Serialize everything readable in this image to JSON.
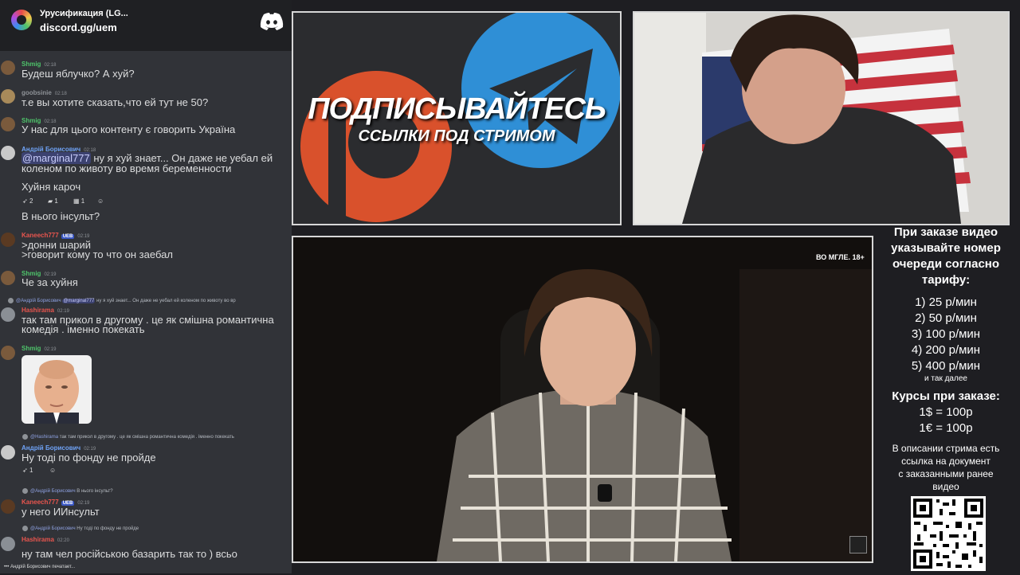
{
  "server": {
    "name": "Урусификация (LG...",
    "invite": "discord.gg/uem"
  },
  "chat": [
    {
      "user": "Shmig",
      "time": "02:18",
      "color": "#4ec36a",
      "lines": [
        "Будеш яблучко? А хуй?"
      ]
    },
    {
      "user": "goobsinie",
      "time": "02:18",
      "color": "#8e9297",
      "lines": [
        "т.е вы хотите сказать,что ей тут не 50?"
      ]
    },
    {
      "user": "Shmig",
      "time": "02:18",
      "color": "#4ec36a",
      "lines": [
        "У нас для цього контенту є говорить Україна"
      ]
    },
    {
      "user": "Андрій Борисович",
      "time": "02:18",
      "color": "#6fa3f7",
      "mention": "@marginal777",
      "lines": [
        " ну я хуй знает... Он даже не уебал ей",
        "коленом по животу во время беременности"
      ],
      "extra": [
        "Хуйня кароч",
        "В нього інсульт?"
      ],
      "reactions": [
        "2",
        "1",
        "1"
      ]
    },
    {
      "user": "Kaneech777",
      "time": "02:19",
      "color": "#e8554e",
      "badge": "UEB",
      "lines": [
        ">донни шарий",
        ">говорит кому то что он заебал"
      ]
    },
    {
      "user": "Shmig",
      "time": "02:19",
      "color": "#4ec36a",
      "lines": [
        "Че за хуйня"
      ]
    },
    {
      "reply_user": "@Андрій Борисович",
      "reply_mention": "@marginal777",
      "reply_text": " ну я хуй знает... Он даже не уебал ей коленом по животу во вр",
      "user": "Hashirama",
      "time": "02:19",
      "color": "#e8554e",
      "lines": [
        "так там прикол в другому . це як смішна романтична",
        "комедія . іменно покекать"
      ]
    },
    {
      "user": "Shmig",
      "time": "02:19",
      "color": "#4ec36a",
      "lines": []
    },
    {
      "reply_user": "@Hashirama",
      "reply_text": " так там прикол в другому . це як смішна романтична комедія . іменно покекать",
      "user": "Андрій Борисович",
      "time": "02:19",
      "color": "#6fa3f7",
      "lines": [
        "Ну тоді по фонду не пройде"
      ],
      "reactions": [
        "1"
      ]
    },
    {
      "reply_user": "@Андрій Борисович",
      "reply_text": " В нього інсульт?",
      "user": "Kaneech777",
      "time": "02:19",
      "color": "#e8554e",
      "badge": "UEB",
      "lines": [
        "у него ИИнсульт"
      ]
    },
    {
      "reply_user": "@Андрій Борисович",
      "reply_text": " Ну тоді по фонду не пройде",
      "user": "Hashirama",
      "time": "02:20",
      "color": "#e8554e",
      "lines": [
        "ну там чел російською базарить так то ) всьо"
      ]
    }
  ],
  "typing": "Андрій Борисович печатает...",
  "promo": {
    "title": "ПОДПИСЫВАЙТЕСЬ",
    "subtitle": "ССЫЛКИ ПОД СТРИМОМ"
  },
  "video": {
    "watermark": "ВО МГЛЕ. 18+"
  },
  "info": {
    "heading": [
      "При заказе видео",
      "указывайте номер",
      "очереди согласно",
      "тарифу:"
    ],
    "rates": [
      "1) 25 р/мин",
      "2) 50 р/мин",
      "3) 100 р/мин",
      "4) 200 р/мин",
      "5) 400 р/мин"
    ],
    "etc": "и так далее",
    "fx_title": "Курсы при заказе:",
    "fx": [
      "1$ = 100р",
      "1€ = 100р"
    ],
    "note": [
      "В описании стрима есть",
      "ссылка на документ",
      "с заказанными ранее",
      "видео"
    ]
  },
  "colors": {
    "chat_bg": "#313338",
    "server_bar": "#1f2023",
    "page_bg": "#1e1e22",
    "frame": "#d7d7d7",
    "telegram": "#2f8fd6",
    "patreon": "#d9512c"
  }
}
